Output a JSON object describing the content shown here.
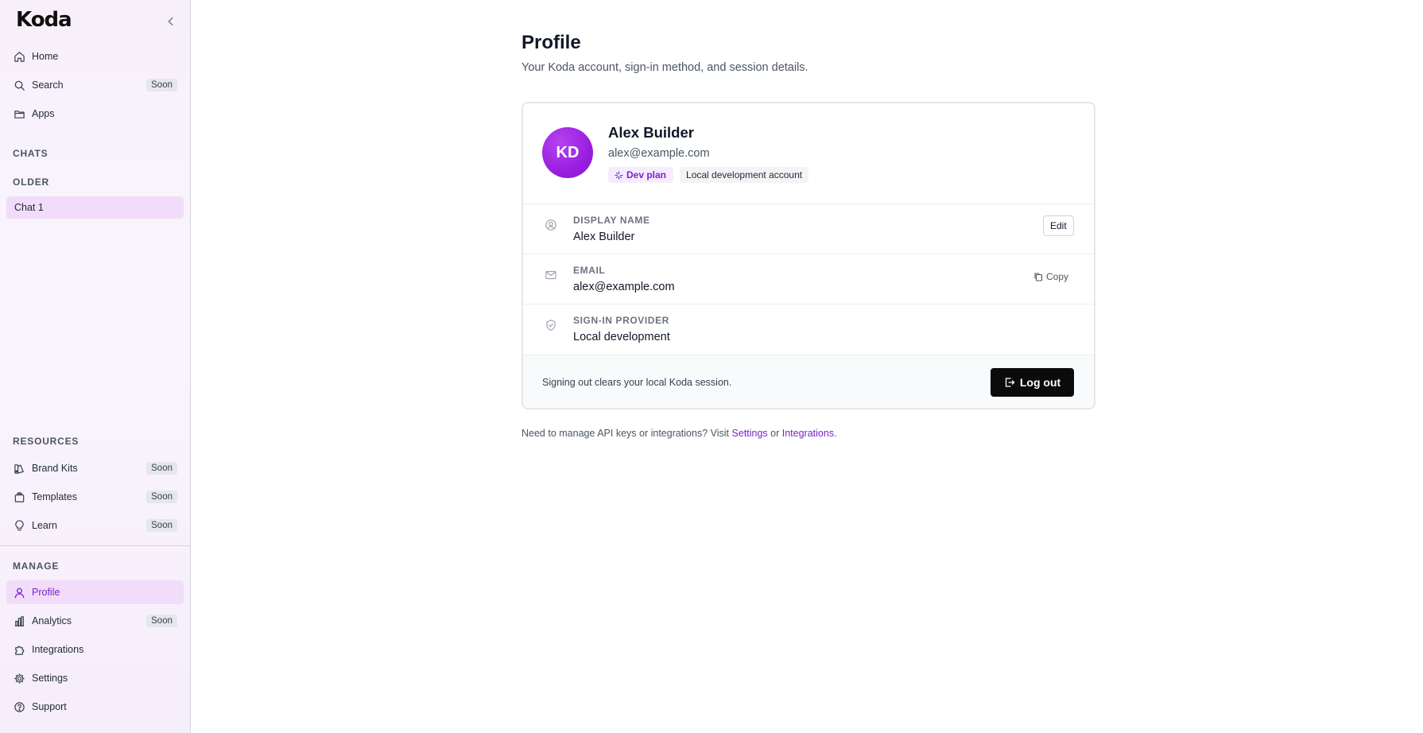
{
  "app": {
    "logo": "Koda"
  },
  "sidebar": {
    "top_items": [
      {
        "label": "Home",
        "icon": "home-icon"
      },
      {
        "label": "Search",
        "icon": "search-icon",
        "badge": "Soon"
      },
      {
        "label": "Apps",
        "icon": "folder-icon"
      }
    ],
    "chats_label": "CHATS",
    "older_label": "OLDER",
    "chats": [
      {
        "label": "Chat 1"
      }
    ],
    "resources_label": "RESOURCES",
    "resources": [
      {
        "label": "Brand Kits",
        "icon": "palette-icon",
        "badge": "Soon"
      },
      {
        "label": "Templates",
        "icon": "layers-icon",
        "badge": "Soon"
      },
      {
        "label": "Learn",
        "icon": "lightbulb-icon",
        "badge": "Soon"
      }
    ],
    "manage_label": "MANAGE",
    "manage": [
      {
        "label": "Profile",
        "icon": "user-icon",
        "active": true
      },
      {
        "label": "Analytics",
        "icon": "bar-chart-icon",
        "badge": "Soon"
      },
      {
        "label": "Integrations",
        "icon": "puzzle-icon"
      },
      {
        "label": "Settings",
        "icon": "gear-icon"
      },
      {
        "label": "Support",
        "icon": "help-circle-icon"
      }
    ]
  },
  "main": {
    "title": "Profile",
    "subtitle": "Your Koda account, sign-in method, and session details.",
    "profile": {
      "initials": "KD",
      "name": "Alex Builder",
      "email": "alex@example.com",
      "plan_badge": "Dev plan",
      "account_badge": "Local development account"
    },
    "rows": {
      "display_name": {
        "label": "DISPLAY NAME",
        "value": "Alex Builder",
        "action": "Edit",
        "icon": "user-circle-icon"
      },
      "email": {
        "label": "EMAIL",
        "value": "alex@example.com",
        "action": "Copy",
        "icon": "mail-icon"
      },
      "provider": {
        "label": "SIGN-IN PROVIDER",
        "value": "Local development",
        "icon": "shield-check-icon"
      }
    },
    "footer": {
      "text": "Signing out clears your local Koda session.",
      "logout_label": "Log out"
    },
    "help": {
      "prefix": "Need to manage API keys or integrations? Visit ",
      "settings_link": "Settings",
      "middle": " or ",
      "integrations_link": "Integrations",
      "suffix": "."
    }
  },
  "colors": {
    "accent": "#7e22ce",
    "active_bg": "#f1dcf9",
    "avatar": "#9a1fe0",
    "logout_bg": "#0b0b0c"
  }
}
